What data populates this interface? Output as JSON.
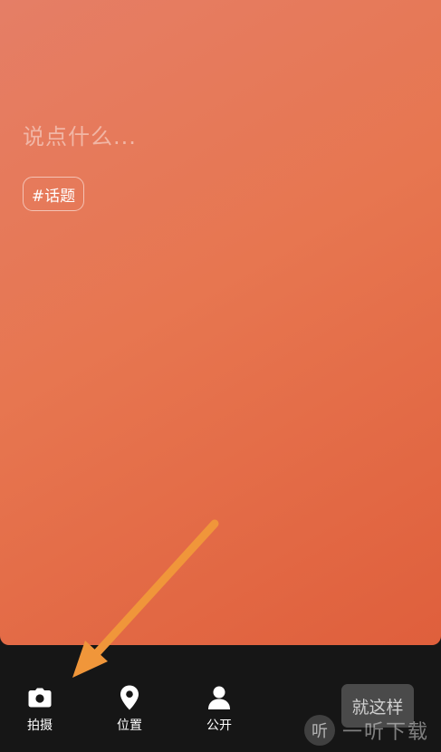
{
  "editor": {
    "placeholder": "说点什么...",
    "topic_tag": "#话题"
  },
  "toolbar": {
    "camera_label": "拍摄",
    "location_label": "位置",
    "visibility_label": "公开",
    "submit_label": "就这样"
  },
  "icons": {
    "camera": "camera-icon",
    "location": "location-pin-icon",
    "visibility": "person-icon",
    "annotation": "arrow-icon"
  },
  "watermark": {
    "logo_char": "听",
    "text": "一听下载"
  },
  "colors": {
    "card_gradient_start": "#e57e66",
    "card_gradient_end": "#df5f3c",
    "toolbar_bg": "#161616",
    "arrow": "#f0963a",
    "submit_bg": "#4a4a4a"
  }
}
